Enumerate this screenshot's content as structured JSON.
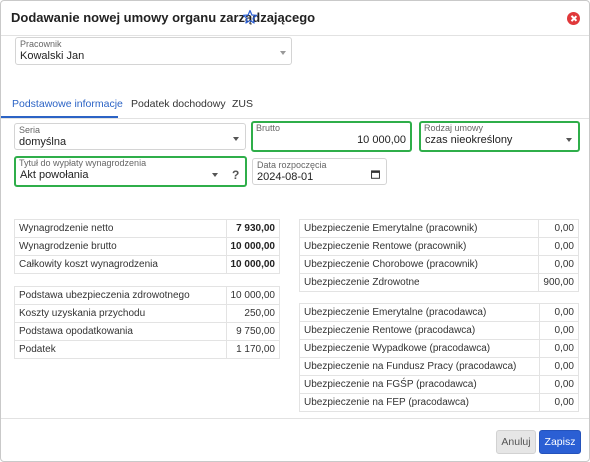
{
  "dialog": {
    "title": "Dodawanie nowej umowy organu zarządzającego"
  },
  "employee": {
    "label": "Pracownik",
    "value": "Kowalski Jan"
  },
  "tabs": [
    {
      "label": "Podstawowe informacje",
      "active": true
    },
    {
      "label": "Podatek dochodowy",
      "active": false
    },
    {
      "label": "ZUS",
      "active": false
    }
  ],
  "form": {
    "seria": {
      "label": "Seria",
      "value": "domyślna"
    },
    "brutto": {
      "label": "Brutto",
      "value": "10 000,00"
    },
    "rodzaj": {
      "label": "Rodzaj umowy",
      "value": "czas nieokreślony"
    },
    "tytul": {
      "label": "Tytuł do wypłaty wynagrodzenia",
      "value": "Akt powołania",
      "help": "?"
    },
    "data": {
      "label": "Data rozpoczęcia",
      "value": "2024-08-01"
    }
  },
  "summary1": [
    {
      "label": "Wynagrodzenie netto",
      "value": "7 930,00"
    },
    {
      "label": "Wynagrodzenie brutto",
      "value": "10 000,00"
    },
    {
      "label": "Całkowity koszt wynagrodzenia",
      "value": "10 000,00"
    }
  ],
  "summary2": [
    {
      "label": "Podstawa ubezpieczenia zdrowotnego",
      "value": "10 000,00"
    },
    {
      "label": "Koszty uzyskania przychodu",
      "value": "250,00"
    },
    {
      "label": "Podstawa opodatkowania",
      "value": "9 750,00"
    },
    {
      "label": "Podatek",
      "value": "1 170,00"
    }
  ],
  "insurance_employee": [
    {
      "label": "Ubezpieczenie Emerytalne (pracownik)",
      "value": "0,00"
    },
    {
      "label": "Ubezpieczenie Rentowe (pracownik)",
      "value": "0,00"
    },
    {
      "label": "Ubezpieczenie Chorobowe (pracownik)",
      "value": "0,00"
    },
    {
      "label": "Ubezpieczenie Zdrowotne",
      "value": "900,00"
    }
  ],
  "insurance_employer": [
    {
      "label": "Ubezpieczenie Emerytalne (pracodawca)",
      "value": "0,00"
    },
    {
      "label": "Ubezpieczenie Rentowe (pracodawca)",
      "value": "0,00"
    },
    {
      "label": "Ubezpieczenie Wypadkowe (pracodawca)",
      "value": "0,00"
    },
    {
      "label": "Ubezpieczenie na Fundusz Pracy (pracodawca)",
      "value": "0,00"
    },
    {
      "label": "Ubezpieczenie na FGŚP (pracodawca)",
      "value": "0,00"
    },
    {
      "label": "Ubezpieczenie na FEP (pracodawca)",
      "value": "0,00"
    }
  ],
  "buttons": {
    "cancel": "Anuluj",
    "save": "Zapisz"
  },
  "colors": {
    "accent": "#2b5fd4",
    "highlight": "#2fae4a",
    "close": "#e0383a"
  },
  "icons": {
    "favorite": "star-outline-icon",
    "close": "close-circle-icon",
    "calendar": "calendar-icon"
  }
}
